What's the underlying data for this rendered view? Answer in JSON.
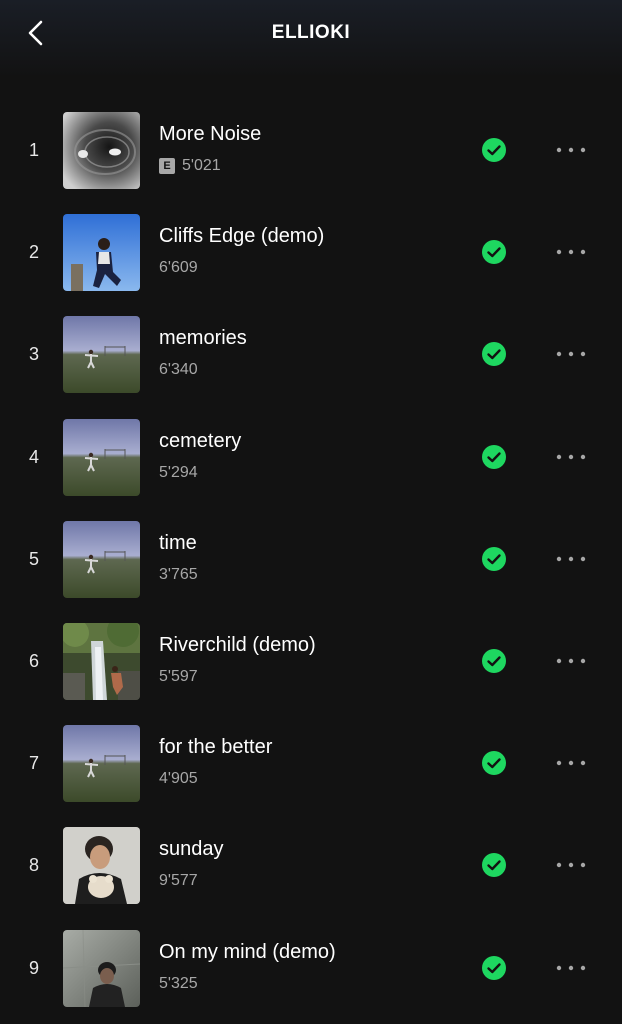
{
  "header": {
    "title": "ELLIOKI",
    "back_icon": "chevron-left-icon"
  },
  "colors": {
    "background": "#121212",
    "downloaded_green": "#1ed760",
    "secondary_text": "#a7a7a7"
  },
  "tracks": [
    {
      "number": "1",
      "title": "More Noise",
      "plays": "5'021",
      "explicit": true,
      "explicit_label": "E",
      "downloaded": true
    },
    {
      "number": "2",
      "title": "Cliffs Edge (demo)",
      "plays": "6'609",
      "explicit": false,
      "downloaded": true
    },
    {
      "number": "3",
      "title": "memories",
      "plays": "6'340",
      "explicit": false,
      "downloaded": true
    },
    {
      "number": "4",
      "title": "cemetery",
      "plays": "5'294",
      "explicit": false,
      "downloaded": true
    },
    {
      "number": "5",
      "title": "time",
      "plays": "3'765",
      "explicit": false,
      "downloaded": true
    },
    {
      "number": "6",
      "title": "Riverchild (demo)",
      "plays": "5'597",
      "explicit": false,
      "downloaded": true
    },
    {
      "number": "7",
      "title": "for the better",
      "plays": "4'905",
      "explicit": false,
      "downloaded": true
    },
    {
      "number": "8",
      "title": "sunday",
      "plays": "9'577",
      "explicit": false,
      "downloaded": true
    },
    {
      "number": "9",
      "title": "On my mind (demo)",
      "plays": "5'325",
      "explicit": false,
      "downloaded": true
    }
  ],
  "row_icons": {
    "downloaded": "checkmark-circle-icon",
    "more": "more-horizontal-icon"
  }
}
